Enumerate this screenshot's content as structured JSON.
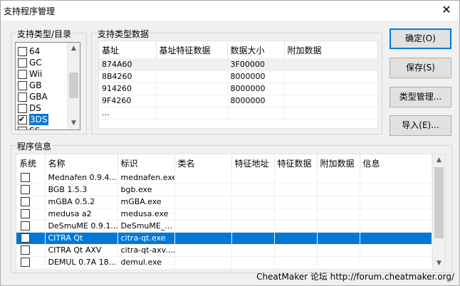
{
  "window": {
    "title": "支持程序管理",
    "close_glyph": "✕"
  },
  "types_group": {
    "label": "支持类型/目录",
    "items": [
      {
        "label": "64",
        "checked": false,
        "selected": false
      },
      {
        "label": "GC",
        "checked": false,
        "selected": false
      },
      {
        "label": "Wii",
        "checked": false,
        "selected": false
      },
      {
        "label": "GB",
        "checked": false,
        "selected": false
      },
      {
        "label": "GBA",
        "checked": false,
        "selected": false
      },
      {
        "label": "DS",
        "checked": false,
        "selected": false
      },
      {
        "label": "3DS",
        "checked": true,
        "selected": true
      },
      {
        "label": "SS",
        "checked": false,
        "selected": false
      }
    ]
  },
  "type_data_group": {
    "label": "支持类型数据",
    "columns": [
      "基址",
      "基址特征数据",
      "数据大小",
      "附加数据"
    ],
    "rows": [
      [
        "874A60",
        "",
        "3F00000",
        ""
      ],
      [
        "8B4260",
        "",
        "8000000",
        ""
      ],
      [
        "914260",
        "",
        "8000000",
        ""
      ],
      [
        "9F4260",
        "",
        "8000000",
        ""
      ],
      [
        "...",
        "",
        "",
        ""
      ]
    ]
  },
  "buttons": {
    "ok": "确定(O)",
    "save": "保存(S)",
    "type_manage": "类型管理...",
    "import": "导入(E)..."
  },
  "program_group": {
    "label": "程序信息",
    "columns": [
      "系统",
      "名称",
      "标识",
      "类名",
      "特征地址",
      "特征数据",
      "附加数据",
      "信息"
    ],
    "rows": [
      {
        "name": "Mednafen 0.9.4...",
        "id": "mednafen.exe",
        "selected": false
      },
      {
        "name": "BGB 1.5.3",
        "id": "bgb.exe",
        "selected": false
      },
      {
        "name": "mGBA 0.5.2",
        "id": "mGBA.exe",
        "selected": false
      },
      {
        "name": "medusa a2",
        "id": "medusa.exe",
        "selected": false
      },
      {
        "name": "DeSmuME 0.9.1...",
        "id": "DeSmuME_...",
        "selected": false
      },
      {
        "name": "CITRA Qt",
        "id": "citra-qt.exe",
        "selected": true
      },
      {
        "name": "CITRA Qt AXV",
        "id": "citra-qt-axv....",
        "selected": false
      },
      {
        "name": "DEMUL 0.7A 18...",
        "id": "demul.exe",
        "selected": false
      }
    ]
  },
  "footer": "CheatMaker 论坛 http://forum.cheatmaker.org/"
}
